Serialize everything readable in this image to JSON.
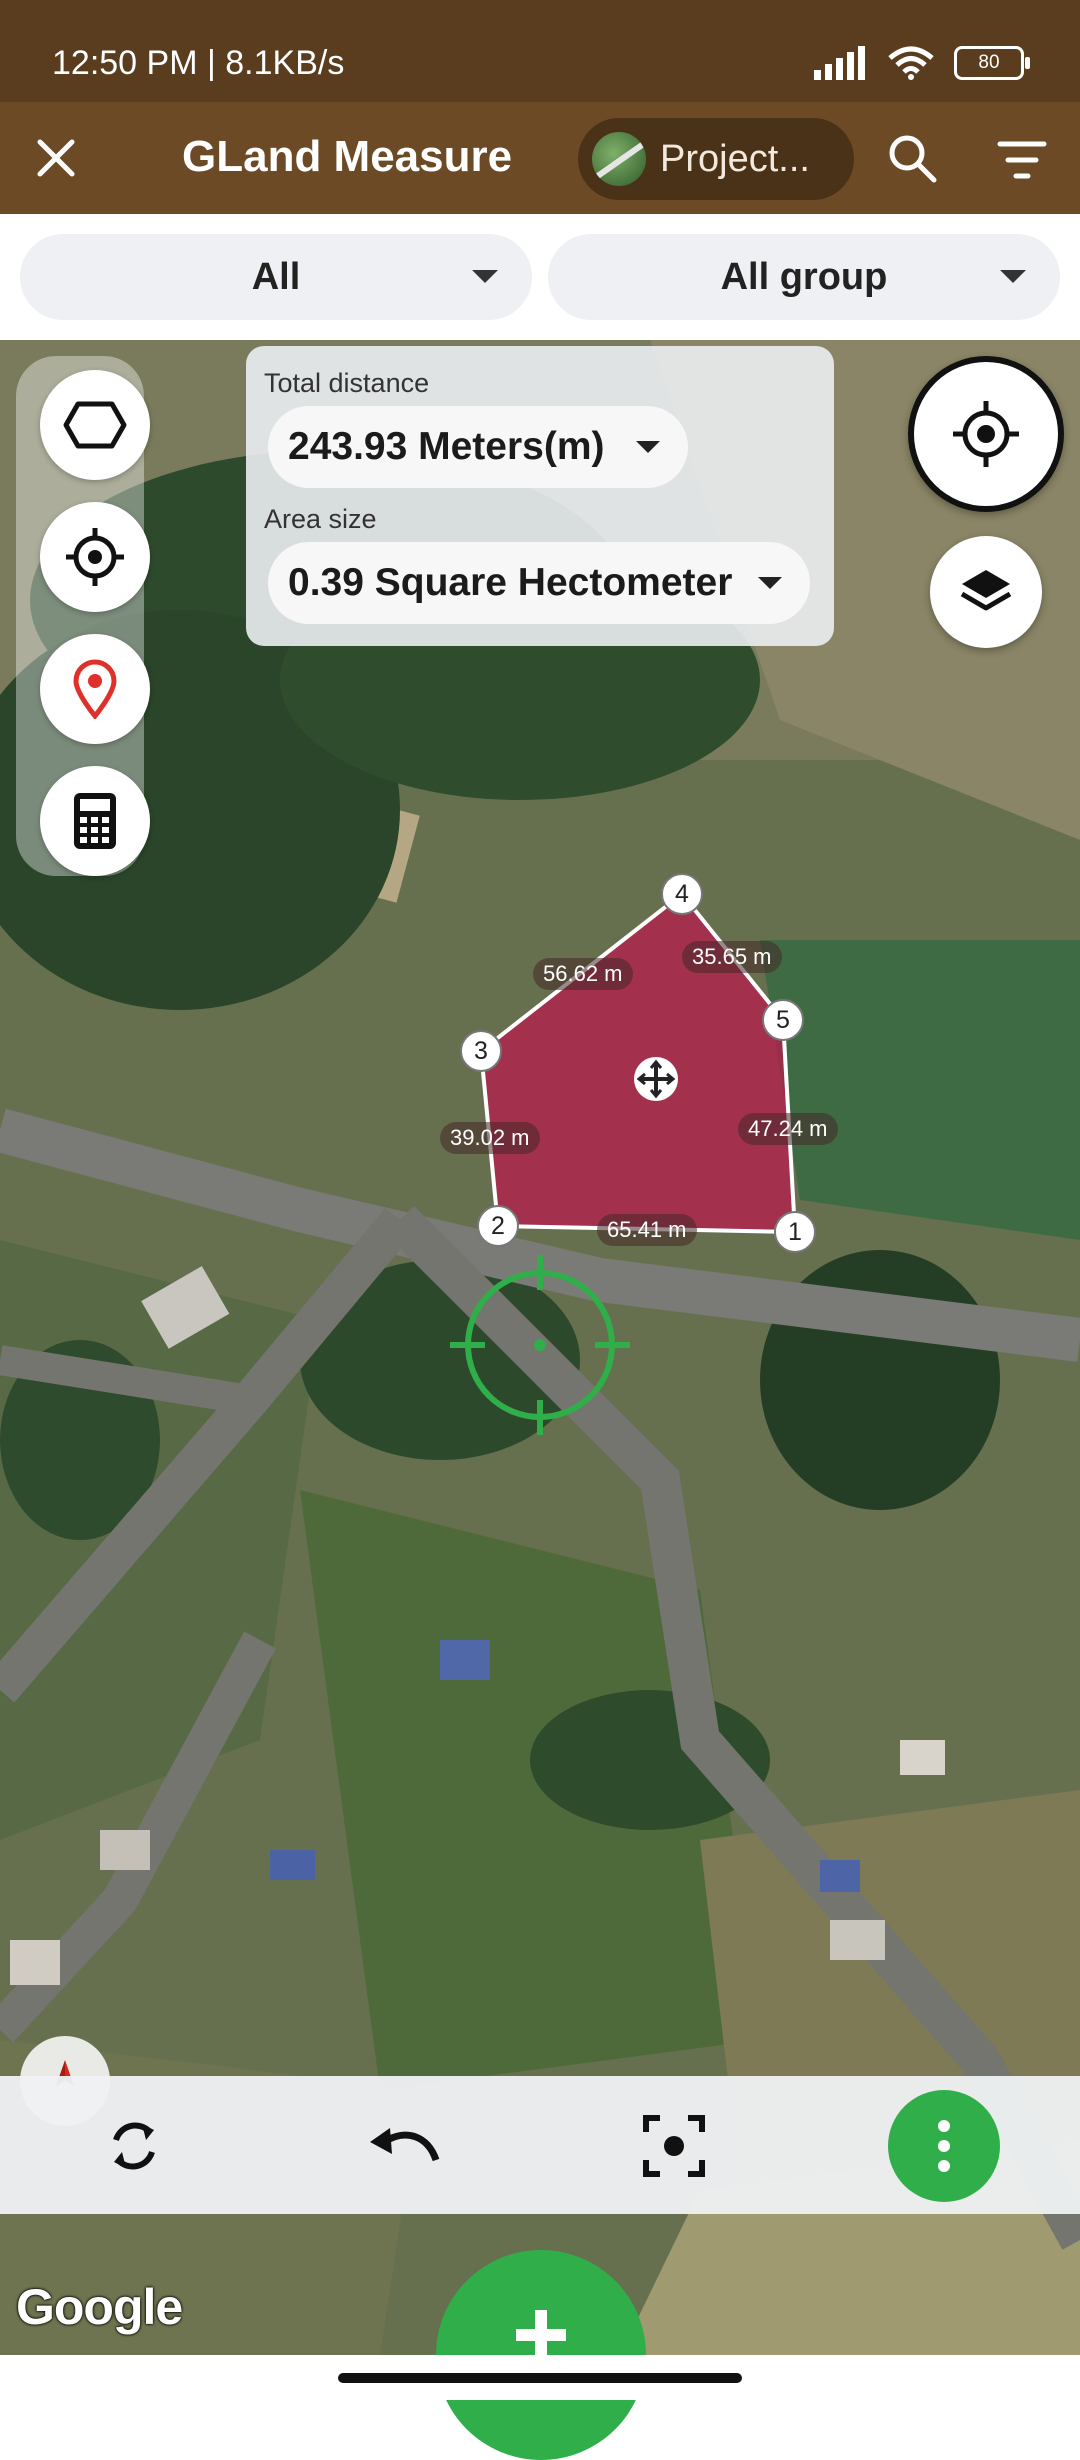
{
  "status_bar": {
    "time_speed": "12:50 PM | 8.1KB/s",
    "battery": "80"
  },
  "app_bar": {
    "title": "GLand Measure",
    "project_label": "Project..."
  },
  "filters": {
    "type": "All",
    "group": "All group"
  },
  "measurements": {
    "distance_caption": "Total distance",
    "distance_value": "243.93 Meters(m)",
    "area_caption": "Area size",
    "area_value": "0.39 Square Hectometer"
  },
  "polygon": {
    "vertices": [
      "1",
      "2",
      "3",
      "4",
      "5"
    ],
    "segments": [
      "65.41 m",
      "39.02 m",
      "56.62 m",
      "35.65 m",
      "47.24 m"
    ],
    "fill_color": "#c0134d"
  },
  "map": {
    "attribution": "Google"
  },
  "colors": {
    "app_bar": "#6b4a25",
    "status_bar": "#5a3d1f",
    "accent_green": "#2fae4a"
  },
  "icons": {
    "tool_1": "polygon-shape-icon",
    "tool_2": "gps-target-icon",
    "tool_3": "location-pin-icon",
    "tool_4": "calculator-icon",
    "right_1": "my-location-icon",
    "right_2": "layers-icon",
    "bottom": [
      "refresh-icon",
      "undo-icon",
      "focus-icon",
      "more-vert-icon"
    ]
  }
}
